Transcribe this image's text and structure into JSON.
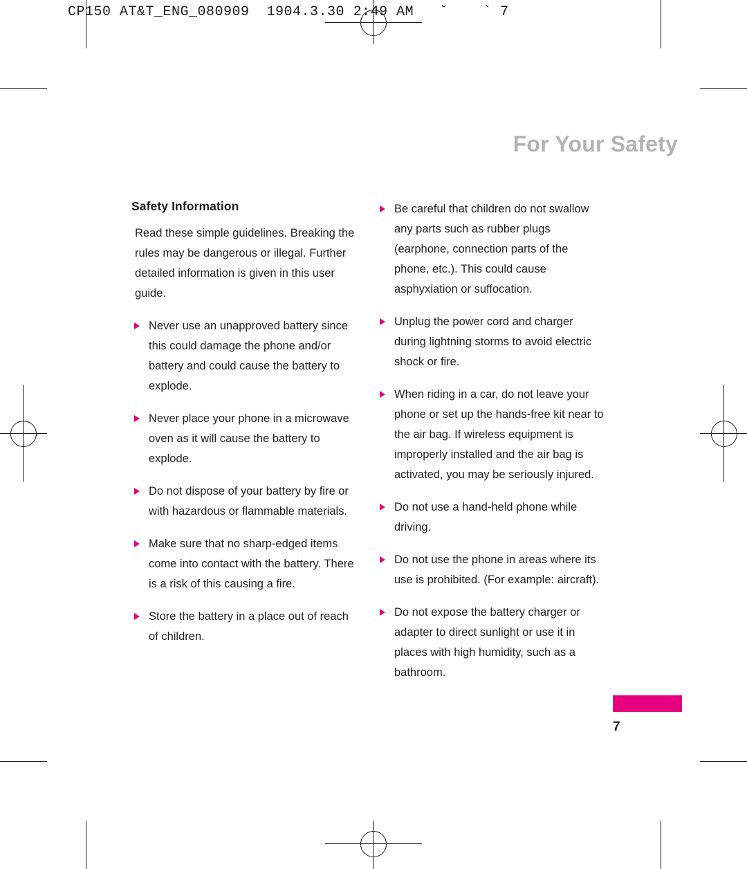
{
  "slug": "CP150 AT&T_ENG_080909  1904.3.30 2:49 AM   ˘    ` 7",
  "page": {
    "title": "For Your Safety",
    "number": "7",
    "accent_color": "#e4007f",
    "title_color": "#b3b3b3"
  },
  "left_column": {
    "heading": "Safety Information",
    "intro": "Read these simple guidelines. Breaking the rules may be dangerous or illegal. Further detailed information is given in this user guide.",
    "bullets": [
      "Never use an unapproved battery since this could damage the phone and/or battery and could cause the battery to explode.",
      "Never place your phone in a microwave oven as it will cause the battery to explode.",
      "Do not dispose of your battery by fire or with hazardous or flammable materials.",
      "Make sure that no sharp-edged items come into contact with the battery. There is a risk of this causing a fire.",
      "Store the battery in a place out of reach of children."
    ]
  },
  "right_column": {
    "bullets": [
      "Be careful that children do not swallow any parts such as rubber plugs (earphone, connection parts of the phone, etc.). This could cause asphyxiation or suffocation.",
      "Unplug the power cord and charger during lightning storms to avoid electric shock or fire.",
      "When riding in a car, do not leave your phone or set up the hands-free kit near to the air bag. If wireless equipment is improperly installed and the air bag is activated, you may be seriously injured.",
      "Do not use a hand-held phone while driving.",
      "Do not use the phone in areas where its use is prohibited. (For example: aircraft).",
      "Do not expose the battery charger or adapter to direct sunlight or use it in places with high humidity, such as a bathroom."
    ]
  }
}
